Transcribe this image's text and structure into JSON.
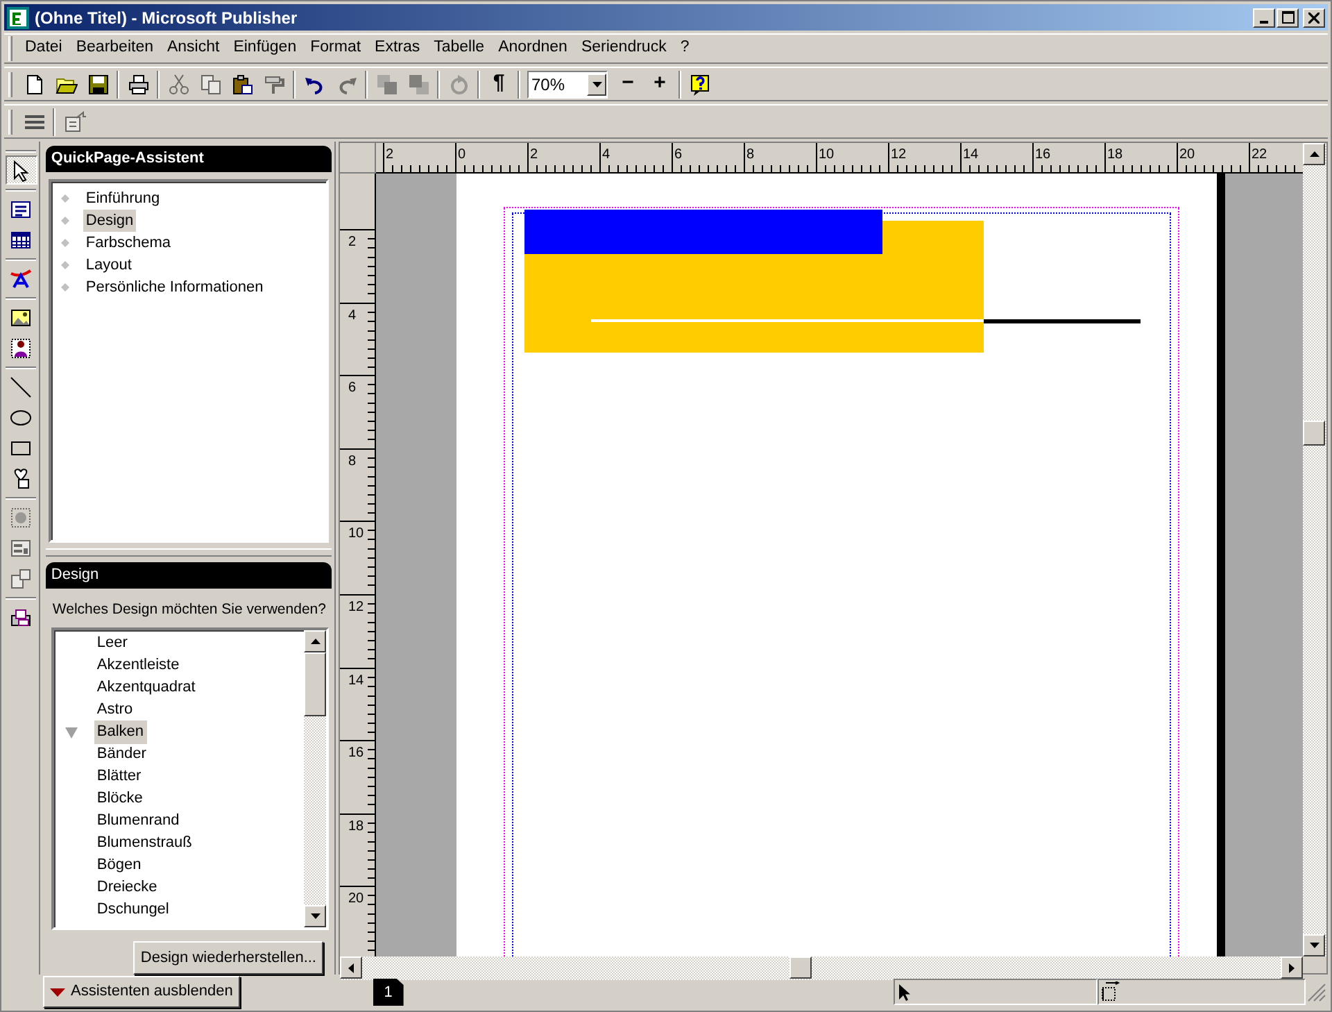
{
  "window": {
    "title": "(Ohne Titel) - Microsoft Publisher"
  },
  "menu": [
    "Datei",
    "Bearbeiten",
    "Ansicht",
    "Einfügen",
    "Format",
    "Extras",
    "Tabelle",
    "Anordnen",
    "Seriendruck",
    "?"
  ],
  "toolbar": [
    {
      "kind": "icon",
      "disabled": false
    },
    {
      "kind": "icon",
      "disabled": false
    },
    {
      "kind": "icon",
      "disabled": false
    },
    {
      "kind": "separator"
    },
    {
      "kind": "icon",
      "disabled": false
    },
    {
      "kind": "separator"
    },
    {
      "kind": "icon",
      "disabled": true
    },
    {
      "kind": "icon",
      "disabled": true
    },
    {
      "kind": "icon",
      "disabled": false
    },
    {
      "kind": "icon",
      "disabled": true
    },
    {
      "kind": "separator"
    },
    {
      "kind": "icon",
      "disabled": false
    },
    {
      "kind": "icon",
      "disabled": true
    },
    {
      "kind": "separator"
    },
    {
      "kind": "icon",
      "disabled": true
    },
    {
      "kind": "icon",
      "disabled": true
    },
    {
      "kind": "separator"
    },
    {
      "kind": "icon",
      "disabled": true
    },
    {
      "kind": "separator"
    },
    {
      "kind": "text",
      "label": "¶",
      "disabled": false
    },
    {
      "kind": "separator"
    },
    {
      "kind": "combo",
      "value": "70%"
    },
    {
      "kind": "text",
      "label": "−",
      "disabled": false
    },
    {
      "kind": "text",
      "label": "+",
      "disabled": false
    },
    {
      "kind": "separator"
    },
    {
      "kind": "icon",
      "disabled": false
    }
  ],
  "toolbar2": [
    {
      "kind": "icon",
      "disabled": false
    },
    {
      "kind": "separator"
    },
    {
      "kind": "icon",
      "disabled": true
    }
  ],
  "tools": [
    {
      "kind": "tool",
      "selected": true,
      "disabled": false
    },
    {
      "kind": "separator"
    },
    {
      "kind": "tool",
      "selected": false,
      "disabled": false
    },
    {
      "kind": "tool",
      "selected": false,
      "disabled": false
    },
    {
      "kind": "separator"
    },
    {
      "kind": "tool",
      "selected": false,
      "disabled": false
    },
    {
      "kind": "separator"
    },
    {
      "kind": "tool",
      "selected": false,
      "disabled": false
    },
    {
      "kind": "tool",
      "selected": false,
      "disabled": false
    },
    {
      "kind": "separator"
    },
    {
      "kind": "tool",
      "selected": false,
      "disabled": false
    },
    {
      "kind": "tool",
      "selected": false,
      "disabled": false
    },
    {
      "kind": "tool",
      "selected": false,
      "disabled": false
    },
    {
      "kind": "tool",
      "selected": false,
      "disabled": false
    },
    {
      "kind": "separator"
    },
    {
      "kind": "tool",
      "selected": false,
      "disabled": true
    },
    {
      "kind": "tool",
      "selected": false,
      "disabled": true
    },
    {
      "kind": "tool",
      "selected": false,
      "disabled": true
    },
    {
      "kind": "separator"
    },
    {
      "kind": "tool",
      "selected": false,
      "disabled": false
    }
  ],
  "wizard": {
    "title": "QuickPage-Assistent",
    "steps": [
      {
        "label": "Einführung",
        "selected": false
      },
      {
        "label": "Design",
        "selected": true
      },
      {
        "label": "Farbschema",
        "selected": false
      },
      {
        "label": "Layout",
        "selected": false
      },
      {
        "label": "Persönliche Informationen",
        "selected": false
      }
    ],
    "section_title": "Design",
    "question": "Welches Design möchten Sie verwenden?",
    "designs": [
      {
        "label": "Leer",
        "selected": false
      },
      {
        "label": "Akzentleiste",
        "selected": false
      },
      {
        "label": "Akzentquadrat",
        "selected": false
      },
      {
        "label": "Astro",
        "selected": false
      },
      {
        "label": "Balken",
        "selected": true
      },
      {
        "label": "Bänder",
        "selected": false
      },
      {
        "label": "Blätter",
        "selected": false
      },
      {
        "label": "Blöcke",
        "selected": false
      },
      {
        "label": "Blumenrand",
        "selected": false
      },
      {
        "label": "Blumenstrauß",
        "selected": false
      },
      {
        "label": "Bögen",
        "selected": false
      },
      {
        "label": "Dreiecke",
        "selected": false
      },
      {
        "label": "Dschungel",
        "selected": false
      }
    ],
    "reset_button": "Design wiederherstellen..."
  },
  "horizontal_ruler": {
    "labels": [
      "2",
      "0",
      "2",
      "4",
      "6",
      "8",
      "10",
      "12",
      "14",
      "16",
      "18",
      "20",
      "22"
    ]
  },
  "vertical_ruler": {
    "labels": [
      "2",
      "4",
      "6",
      "8",
      "10",
      "12",
      "14",
      "16",
      "18",
      "20"
    ]
  },
  "status_bar": {
    "hide_wizard_button": "Assistenten ausblenden",
    "page_tabs": [
      {
        "label": "1",
        "selected": true
      }
    ]
  }
}
